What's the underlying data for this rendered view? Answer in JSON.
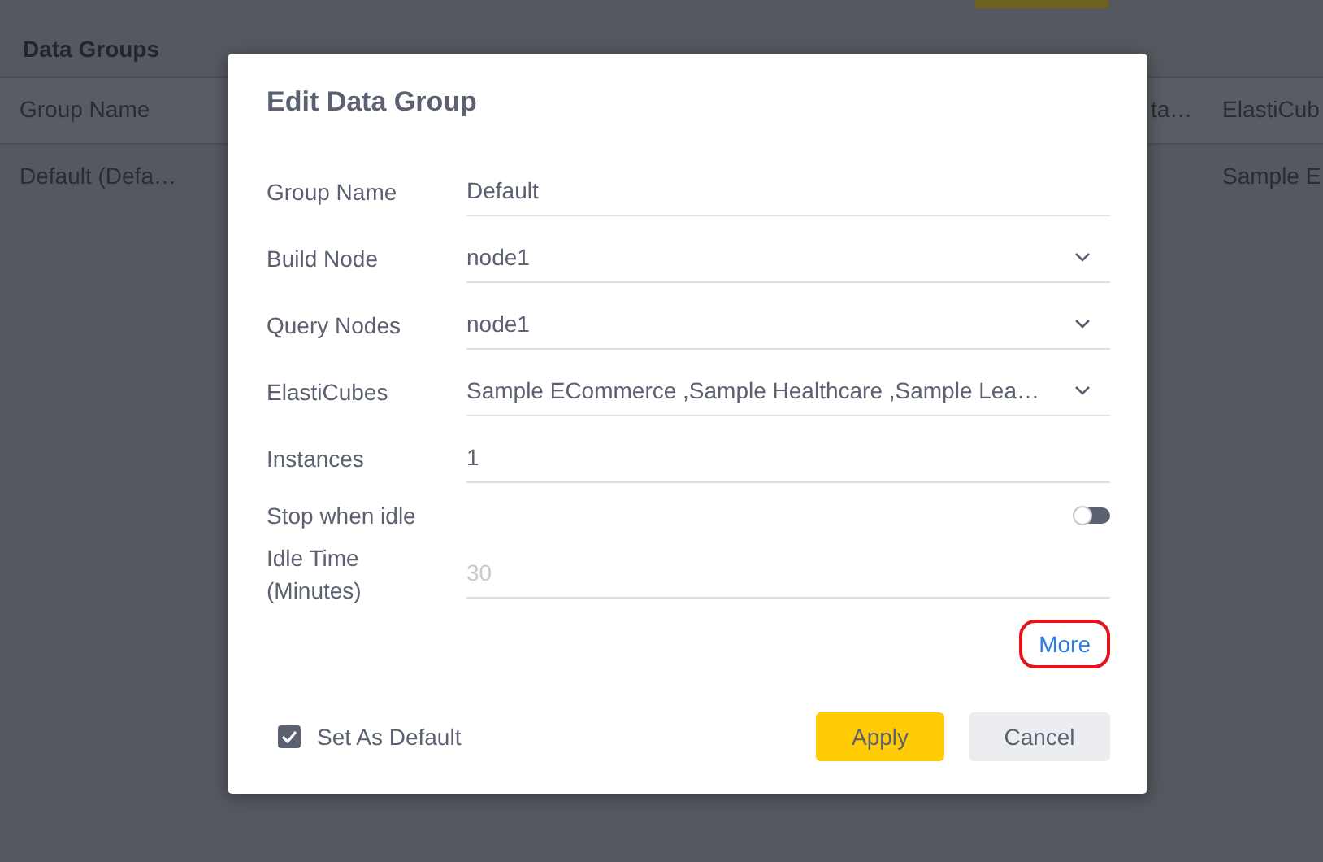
{
  "page": {
    "title": "Data Groups",
    "table": {
      "columns": [
        "Group Name",
        "ta…",
        "ElastiCub"
      ],
      "rows": [
        [
          "Default (Defa…",
          "",
          "Sample E"
        ]
      ]
    }
  },
  "dialog": {
    "title": "Edit Data Group",
    "fields": [
      {
        "kind": "text",
        "label": "Group Name",
        "value": "Default"
      },
      {
        "kind": "select",
        "label": "Build Node",
        "value": "node1"
      },
      {
        "kind": "select",
        "label": "Query Nodes",
        "value": "node1"
      },
      {
        "kind": "select",
        "label": "ElastiCubes",
        "value": "Sample ECommerce ,Sample Healthcare ,Sample Lea…"
      },
      {
        "kind": "text",
        "label": "Instances",
        "value": "1"
      },
      {
        "kind": "toggle",
        "label": "Stop when idle",
        "on": false
      },
      {
        "kind": "disabled",
        "label": "Idle Time\n(Minutes)",
        "placeholder": "30"
      }
    ],
    "more_link": "More",
    "set_default": {
      "label": "Set As Default",
      "checked": true
    },
    "buttons": [
      {
        "kind": "primary",
        "label": "Apply"
      },
      {
        "kind": "secondary",
        "label": "Cancel"
      }
    ]
  }
}
